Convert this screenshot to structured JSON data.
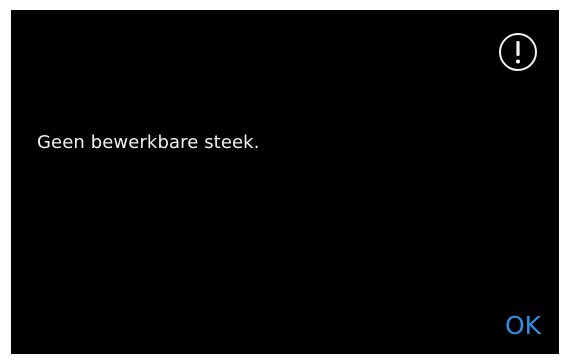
{
  "dialog": {
    "icon": "exclamation-circle-icon",
    "message": "Geen bewerkbare steek.",
    "ok_label": "OK"
  },
  "colors": {
    "background": "#000000",
    "text": "#f2f2f2",
    "accent": "#2f8ee0"
  }
}
